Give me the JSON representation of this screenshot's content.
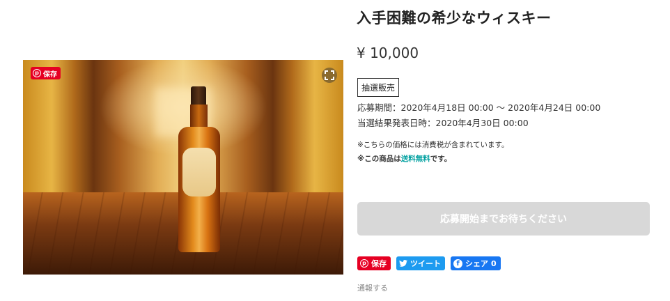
{
  "product": {
    "title": "入手困難の希少なウィスキー",
    "price": "¥ 10,000",
    "sale_type": "抽選販売",
    "application_period": "応募期間：2020年4月18日 00:00 〜 2020年4月24日 00:00",
    "result_date": "当選結果発表日時：2020年4月30日 00:00",
    "tax_note": "※こちらの価格には消費税が含まれています。",
    "shipping_note_prefix": "※この商品は",
    "shipping_note_highlight": "送料無料",
    "shipping_note_suffix": "です。",
    "apply_button_label": "応募開始までお待ちください"
  },
  "gallery": {
    "pin_save_label": "保存",
    "zoom_icon": "expand-icon"
  },
  "share": {
    "pinterest_label": "保存",
    "twitter_label": "ツイート",
    "facebook_label": "シェア",
    "facebook_count": "0"
  },
  "report_label": "通報する",
  "colors": {
    "accent_free_shipping": "#00a0a0",
    "pinterest": "#e60023",
    "twitter": "#1d9bf0",
    "facebook": "#1877f2",
    "disabled_button": "#d8d8d8"
  }
}
